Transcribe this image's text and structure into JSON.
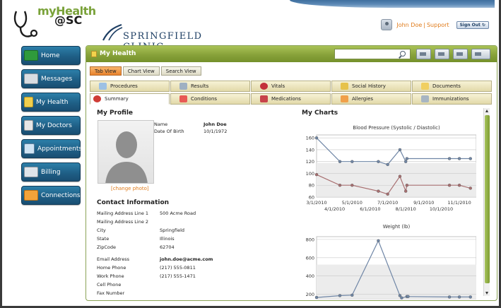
{
  "brand": {
    "line1": "myHealth",
    "line2": "@SC"
  },
  "clinic": {
    "name": "SPRINGFIELD CLINIC"
  },
  "user_bar": {
    "user_name": "John Doe",
    "separator": "|",
    "support_label": "Support",
    "signout_label": "Sign Out"
  },
  "sidebar": {
    "items": [
      {
        "label": "Home",
        "icon": "home-icon",
        "color": "#2f9a3c"
      },
      {
        "label": "Messages",
        "icon": "envelope-icon",
        "color": "#d9dde2"
      },
      {
        "label": "My Health",
        "icon": "document-icon",
        "color": "#f1cf4d"
      },
      {
        "label": "My Doctors",
        "icon": "doctor-icon",
        "color": "#e6e6e6"
      },
      {
        "label": "Appointments",
        "icon": "calendar-icon",
        "color": "#cfe3f3"
      },
      {
        "label": "Billing",
        "icon": "pen-icon",
        "color": "#dfe4ea"
      },
      {
        "label": "Connections",
        "icon": "handshake-icon",
        "color": "#f2a33a"
      }
    ]
  },
  "main": {
    "title": "My Health",
    "search": {
      "value": "",
      "placeholder": ""
    }
  },
  "view_tabs": [
    "Tab View",
    "Chart View",
    "Search View"
  ],
  "record_tabs": {
    "row1": [
      "Procedures",
      "Results",
      "Vitals",
      "Social History",
      "Documents"
    ],
    "row2": [
      "Summary",
      "Conditions",
      "Medications",
      "Allergies",
      "Immunizations"
    ]
  },
  "profile": {
    "title": "My Profile",
    "change_photo": "[change photo]",
    "name_label": "Name",
    "name_value": "John Doe",
    "dob_label": "Date Of Birth",
    "dob_value": "10/1/1972"
  },
  "contact": {
    "title": "Contact Information",
    "rows": [
      {
        "label": "Mailing Address Line 1",
        "value": "500 Acme Road"
      },
      {
        "label": "Mailing Address Line 2",
        "value": ""
      },
      {
        "label": "City",
        "value": "Springfield"
      },
      {
        "label": "State",
        "value": "Illinois"
      },
      {
        "label": "ZipCode",
        "value": "62704"
      },
      {
        "label": "Email Address",
        "value": "john.doe@acme.com"
      },
      {
        "label": "Home Phone",
        "value": "(217) 555-0811"
      },
      {
        "label": "Work Phone",
        "value": "(217) 555-1471"
      },
      {
        "label": "Cell Phone",
        "value": ""
      },
      {
        "label": "Fax Number",
        "value": ""
      }
    ]
  },
  "charts": {
    "title": "My Charts"
  },
  "chart_data": [
    {
      "type": "line",
      "title": "Blood Pressure (Systolic / Diastolic)",
      "xlabel": "",
      "ylabel": "",
      "ylim": [
        60,
        165
      ],
      "yticks": [
        60,
        80,
        100,
        120,
        140,
        160
      ],
      "xticks_row1": [
        "3/1/2010",
        "5/1/2010",
        "7/1/2010",
        "9/1/2010",
        "11/1/2010"
      ],
      "xticks_row2": [
        "4/1/2010",
        "6/1/2010",
        "8/1/2010",
        "10/1/2010"
      ],
      "xlim": [
        "3/1/2010",
        "11/30/2010"
      ],
      "grid": true,
      "series": [
        {
          "color": "#6f86a6",
          "points": [
            [
              "3/1/2010",
              160
            ],
            [
              "4/10/2010",
              120
            ],
            [
              "5/1/2010",
              120
            ],
            [
              "6/15/2010",
              120
            ],
            [
              "7/1/2010",
              115
            ],
            [
              "7/22/2010",
              140
            ],
            [
              "8/1/2010",
              120
            ],
            [
              "8/3/2010",
              125
            ],
            [
              "10/15/2010",
              125
            ],
            [
              "11/1/2010",
              125
            ],
            [
              "11/20/2010",
              125
            ]
          ]
        },
        {
          "color": "#a86f70",
          "points": [
            [
              "3/1/2010",
              98
            ],
            [
              "4/10/2010",
              80
            ],
            [
              "5/1/2010",
              80
            ],
            [
              "6/15/2010",
              70
            ],
            [
              "7/1/2010",
              65
            ],
            [
              "7/22/2010",
              95
            ],
            [
              "8/1/2010",
              70
            ],
            [
              "8/3/2010",
              80
            ],
            [
              "10/15/2010",
              80
            ],
            [
              "11/1/2010",
              80
            ],
            [
              "11/20/2010",
              75
            ]
          ]
        }
      ]
    },
    {
      "type": "line",
      "title": "Weight (lb)",
      "xlabel": "",
      "ylabel": "",
      "ylim": [
        150,
        830
      ],
      "yticks": [
        200,
        400,
        600,
        800
      ],
      "xlim": [
        "3/1/2010",
        "11/30/2010"
      ],
      "grid": true,
      "series": [
        {
          "color": "#6f86a6",
          "points": [
            [
              "3/1/2010",
              165
            ],
            [
              "4/10/2010",
              185
            ],
            [
              "5/1/2010",
              190
            ],
            [
              "6/15/2010",
              785
            ],
            [
              "7/22/2010",
              185
            ],
            [
              "7/25/2010",
              160
            ],
            [
              "8/3/2010",
              175
            ],
            [
              "8/5/2010",
              175
            ],
            [
              "10/15/2010",
              170
            ],
            [
              "11/1/2010",
              170
            ],
            [
              "11/20/2010",
              170
            ]
          ]
        }
      ]
    }
  ]
}
